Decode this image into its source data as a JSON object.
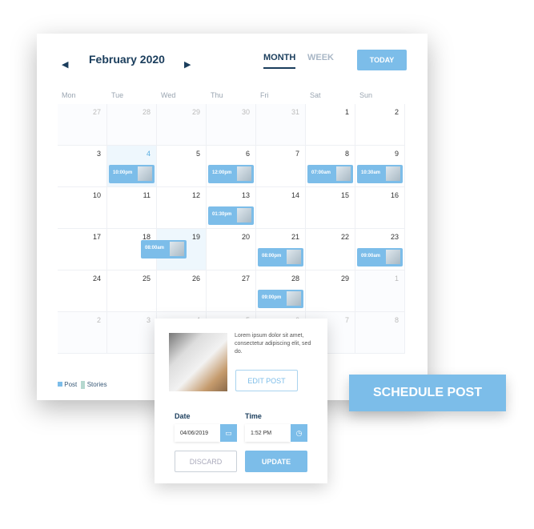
{
  "header": {
    "title": "February 2020",
    "prev_icon": "caret-left",
    "next_icon": "caret-right",
    "tabs": [
      {
        "label": "MONTH",
        "active": true
      },
      {
        "label": "WEEK",
        "active": false
      }
    ],
    "today": "TODAY"
  },
  "weekdays": [
    "Mon",
    "Tue",
    "Wed",
    "Thu",
    "Fri",
    "Sat",
    "Sun"
  ],
  "days": [
    {
      "d": "27",
      "o": true
    },
    {
      "d": "28",
      "o": true
    },
    {
      "d": "29",
      "o": true
    },
    {
      "d": "30",
      "o": true
    },
    {
      "d": "31",
      "o": true
    },
    {
      "d": "1"
    },
    {
      "d": "2"
    },
    {
      "d": "3"
    },
    {
      "d": "4",
      "today": true
    },
    {
      "d": "5"
    },
    {
      "d": "6"
    },
    {
      "d": "7"
    },
    {
      "d": "8"
    },
    {
      "d": "9"
    },
    {
      "d": "10"
    },
    {
      "d": "11"
    },
    {
      "d": "12"
    },
    {
      "d": "13"
    },
    {
      "d": "14"
    },
    {
      "d": "15"
    },
    {
      "d": "16"
    },
    {
      "d": "17"
    },
    {
      "d": "18"
    },
    {
      "d": "19",
      "sel": true
    },
    {
      "d": "20"
    },
    {
      "d": "21"
    },
    {
      "d": "22"
    },
    {
      "d": "23"
    },
    {
      "d": "24"
    },
    {
      "d": "25"
    },
    {
      "d": "26"
    },
    {
      "d": "27"
    },
    {
      "d": "28"
    },
    {
      "d": "29"
    },
    {
      "d": "1",
      "o": true
    },
    {
      "d": "2",
      "o": true
    },
    {
      "d": "3",
      "o": true
    },
    {
      "d": "4",
      "o": true
    },
    {
      "d": "5",
      "o": true
    },
    {
      "d": "6",
      "o": true
    },
    {
      "d": "7",
      "o": true
    },
    {
      "d": "8",
      "o": true
    }
  ],
  "events": [
    {
      "day": "4",
      "time": "10:00pm"
    },
    {
      "day": "6",
      "time": "12:00pm"
    },
    {
      "day": "8",
      "time": "07:00am"
    },
    {
      "day": "9",
      "time": "10:30am"
    },
    {
      "day": "13",
      "time": "01:30pm"
    },
    {
      "day": "18",
      "time": "08:00am"
    },
    {
      "day": "21",
      "time": "08:00pm"
    },
    {
      "day": "23",
      "time": "09:00am"
    },
    {
      "day": "28",
      "time": "09:00pm"
    }
  ],
  "legend": {
    "post": "Post",
    "stories": "Stories",
    "post_color": "#7cbde9",
    "stories_color": "#b5d8cf"
  },
  "popup": {
    "description": "Lorem ipsum dolor sit amet, consectetur adipiscing elit, sed do.",
    "edit": "EDIT POST",
    "date_label": "Date",
    "date_value": "04/06/2019",
    "time_label": "Time",
    "time_value": "1:52 PM",
    "discard": "DISCARD",
    "update": "UPDATE"
  },
  "schedule": "SCHEDULE POST",
  "colors": {
    "accent": "#7cbde9",
    "dark": "#1a3d5c"
  }
}
